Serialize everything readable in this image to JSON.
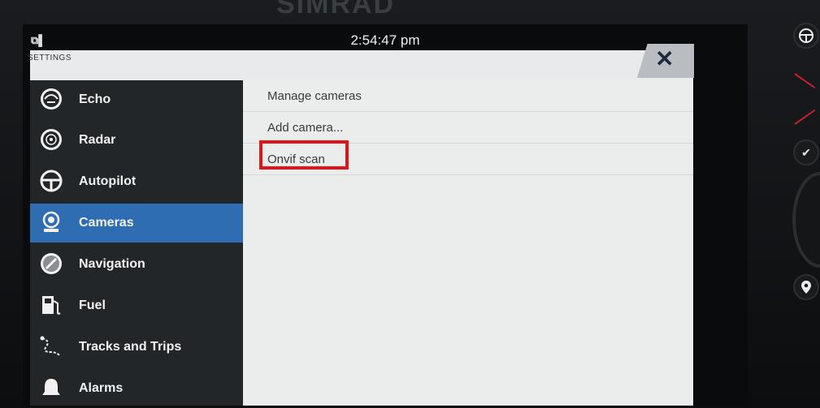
{
  "status": {
    "signal_icon": "signal-icon",
    "signal_text": "⧉▌",
    "time": "2:54:47 pm"
  },
  "panel": {
    "title": "SETTINGS",
    "close_icon": "close-icon",
    "close_glyph": "✕"
  },
  "sidebar": {
    "items": [
      {
        "label": "Echo",
        "icon": "echo-icon"
      },
      {
        "label": "Radar",
        "icon": "radar-icon"
      },
      {
        "label": "Autopilot",
        "icon": "autopilot-wheel-icon"
      },
      {
        "label": "Cameras",
        "icon": "camera-icon",
        "selected": true
      },
      {
        "label": "Navigation",
        "icon": "compass-icon"
      },
      {
        "label": "Fuel",
        "icon": "fuel-pump-icon"
      },
      {
        "label": "Tracks and Trips",
        "icon": "tracks-icon"
      },
      {
        "label": "Alarms",
        "icon": "alarm-bell-icon"
      }
    ]
  },
  "content": {
    "items": [
      {
        "label": "Manage cameras"
      },
      {
        "label": "Add camera..."
      },
      {
        "label": "Onvif scan",
        "highlighted": true
      }
    ]
  },
  "hardware": {
    "buttons": [
      "autopilot-button-icon",
      "check-icon",
      "waypoint-pin-icon"
    ],
    "check_glyph": "✔",
    "pin_glyph": "●"
  },
  "colors": {
    "selected": "#2f6db3",
    "highlight_box": "#e0141b",
    "sidebar_bg": "#232629",
    "content_bg": "#ebecec"
  }
}
